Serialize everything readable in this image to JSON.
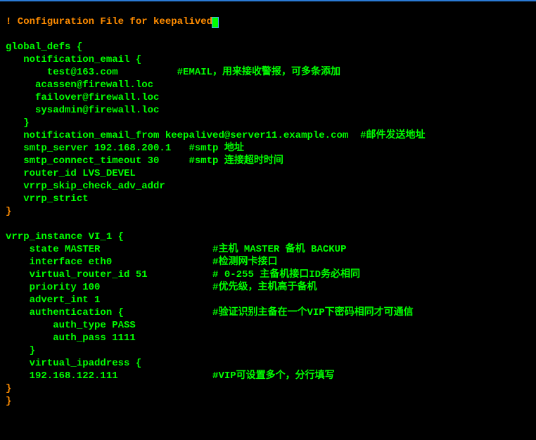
{
  "lines": {
    "l0a": "! Configuration File for keepalived",
    "l1": "",
    "l2": "global_defs {",
    "l3": "   notification_email {",
    "l4": "       test@163.com          #EMAIL，用来接收警报，可多条添加",
    "l5": "     acassen@firewall.loc",
    "l6": "     failover@firewall.loc",
    "l7": "     sysadmin@firewall.loc",
    "l8": "   }",
    "l9": "   notification_email_from keepalived@server11.example.com  #邮件发送地址",
    "l10": "   smtp_server 192.168.200.1   #smtp 地址",
    "l11": "   smtp_connect_timeout 30     #smtp 连接超时时间",
    "l12": "   router_id LVS_DEVEL",
    "l13": "   vrrp_skip_check_adv_addr",
    "l14": "   vrrp_strict",
    "l15": "}",
    "l16": "",
    "l17": "vrrp_instance VI_1 {",
    "l18": "    state MASTER                   #主机 MASTER 备机 BACKUP",
    "l19": "    interface eth0                 #检测网卡接口",
    "l20": "    virtual_router_id 51           # 0-255 主备机接口ID务必相同",
    "l21": "    priority 100                   #优先级，主机高于备机",
    "l22": "    advert_int 1",
    "l23": "    authentication {               #验证识别主备在一个VIP下密码相同才可通信",
    "l24": "        auth_type PASS",
    "l25": "        auth_pass 1111",
    "l26": "    }",
    "l27": "    virtual_ipaddress {",
    "l28": "    192.168.122.111                #VIP可设置多个，分行填写",
    "l29": "}",
    "l30": "}"
  }
}
